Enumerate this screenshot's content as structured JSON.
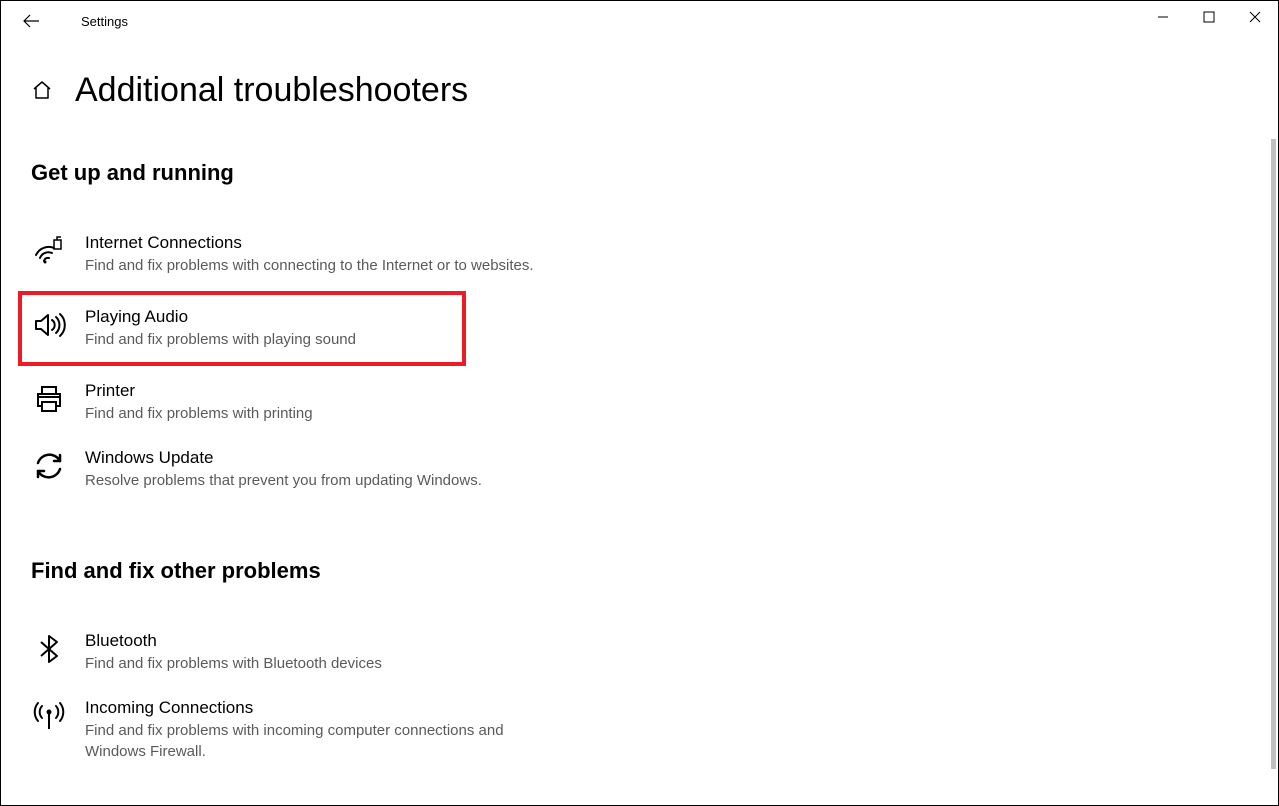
{
  "window": {
    "title": "Settings"
  },
  "page": {
    "title": "Additional troubleshooters"
  },
  "sections": {
    "s1": {
      "title": "Get up and running",
      "items": [
        {
          "title": "Internet Connections",
          "desc": "Find and fix problems with connecting to the Internet or to websites."
        },
        {
          "title": "Playing Audio",
          "desc": "Find and fix problems with playing sound"
        },
        {
          "title": "Printer",
          "desc": "Find and fix problems with printing"
        },
        {
          "title": "Windows Update",
          "desc": "Resolve problems that prevent you from updating Windows."
        }
      ]
    },
    "s2": {
      "title": "Find and fix other problems",
      "items": [
        {
          "title": "Bluetooth",
          "desc": "Find and fix problems with Bluetooth devices"
        },
        {
          "title": "Incoming Connections",
          "desc": "Find and fix problems with incoming computer connections and Windows Firewall."
        }
      ]
    }
  }
}
